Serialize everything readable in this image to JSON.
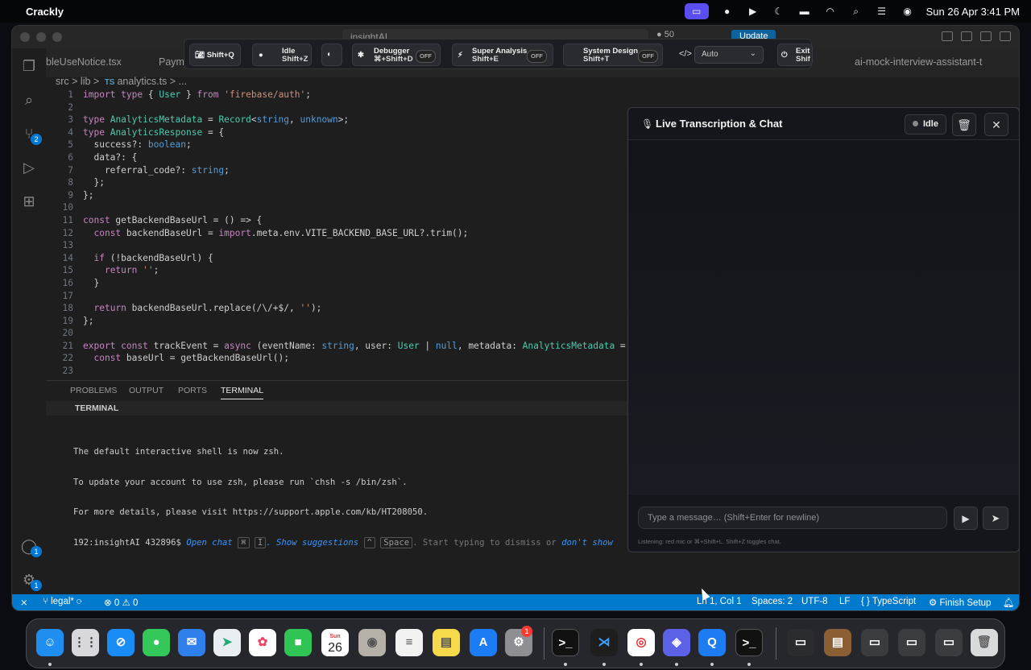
{
  "menubar": {
    "app_name": "Crackly",
    "datetime": "Sun 26 Apr  3:41 PM",
    "icons": [
      "screen-share-icon",
      "chat-bubble-icon",
      "play-icon",
      "moon-icon",
      "battery-icon",
      "wifi-icon",
      "search-icon",
      "control-center-icon",
      "siri-icon"
    ]
  },
  "window": {
    "search_text": "insightAI",
    "badge_count": "50",
    "update_label": "Update",
    "workspace_tab": "ai-mock-interview-assistant-t"
  },
  "tabs": [
    {
      "label": "bleUseNotice.tsx"
    },
    {
      "label": "Payme"
    }
  ],
  "breadcrumb": {
    "src": "src",
    "lib": "lib",
    "lang": "TS",
    "file": "analytics.ts",
    "more": "..."
  },
  "editor": {
    "lines": [
      {
        "n": "1"
      },
      {
        "n": "2"
      },
      {
        "n": "3"
      },
      {
        "n": "4"
      },
      {
        "n": "5"
      },
      {
        "n": "6"
      },
      {
        "n": "7"
      },
      {
        "n": "8"
      },
      {
        "n": "9"
      },
      {
        "n": "10"
      },
      {
        "n": "11"
      },
      {
        "n": "12"
      },
      {
        "n": "13"
      },
      {
        "n": "14"
      },
      {
        "n": "15"
      },
      {
        "n": "16"
      },
      {
        "n": "17"
      },
      {
        "n": "18"
      },
      {
        "n": "19"
      },
      {
        "n": "20"
      },
      {
        "n": "21"
      },
      {
        "n": "22"
      },
      {
        "n": "23"
      }
    ],
    "code": [
      "import type { User } from 'firebase/auth';",
      "",
      "type AnalyticsMetadata = Record<string, unknown>;",
      "type AnalyticsResponse = {",
      "  success?: boolean;",
      "  data?: {",
      "    referral_code?: string;",
      "  };",
      "};",
      "",
      "const getBackendBaseUrl = () => {",
      "  const backendBaseUrl = import.meta.env.VITE_BACKEND_BASE_URL?.trim();",
      "",
      "  if (!backendBaseUrl) {",
      "    return '';",
      "  }",
      "",
      "  return backendBaseUrl.replace(/\\/+$/, '');",
      "};",
      "",
      "export const trackEvent = async (eventName: string, user: User | null, metadata: AnalyticsMetadata = {}) => {",
      "  const baseUrl = getBackendBaseUrl();",
      ""
    ]
  },
  "panel": {
    "tabs": [
      "PROBLEMS",
      "OUTPUT",
      "PORTS",
      "TERMINAL"
    ],
    "active": "TERMINAL",
    "terminal_header": "TERMINAL",
    "terminal_lines": [
      "The default interactive shell is now zsh.",
      "To update your account to use zsh, please run `chsh -s /bin/zsh`.",
      "For more details, please visit https://support.apple.com/kb/HT208050."
    ],
    "prompt": "192:insightAI 432896$ ",
    "hint_open_chat": "Open chat",
    "hint_key1": "⌘",
    "hint_key2": "I",
    "hint_show": ". Show suggestions",
    "hint_key3": "^",
    "hint_key4": "Space",
    "hint_rest": ". Start typing to dismiss or ",
    "hint_dont": "don't show"
  },
  "statusbar": {
    "branch": "legal*",
    "errors": "0",
    "warnings": "0",
    "position": "Ln 1, Col 1",
    "spaces": "Spaces: 2",
    "encoding": "UTF-8",
    "eol": "LF",
    "language": "TypeScript",
    "setup": "Finish Setup"
  },
  "toolbar": {
    "capture_shortcut": "Shift+Q",
    "idle_label": "Idle",
    "idle_shortcut": "Shift+Z",
    "debugger_label": "Debugger",
    "debugger_shortcut": "⌘+Shift+D",
    "super_label": "Super Analysis",
    "super_shortcut": "Shift+E",
    "sysdesign_label": "System Design",
    "sysdesign_shortcut": "Shift+T",
    "off": "OFF",
    "mode": "Auto",
    "exit_label": "Exit",
    "exit_shortcut": "Shif"
  },
  "chat": {
    "title": "Live Transcription & Chat",
    "status": "Idle",
    "placeholder": "Type a message… (Shift+Enter for newline)",
    "hint": "Listening: red mic or ⌘+Shift+L. Shift+Z toggles chat."
  },
  "dock": {
    "calendar_month": "Sun",
    "calendar_day": "26",
    "settings_badge": "1"
  }
}
